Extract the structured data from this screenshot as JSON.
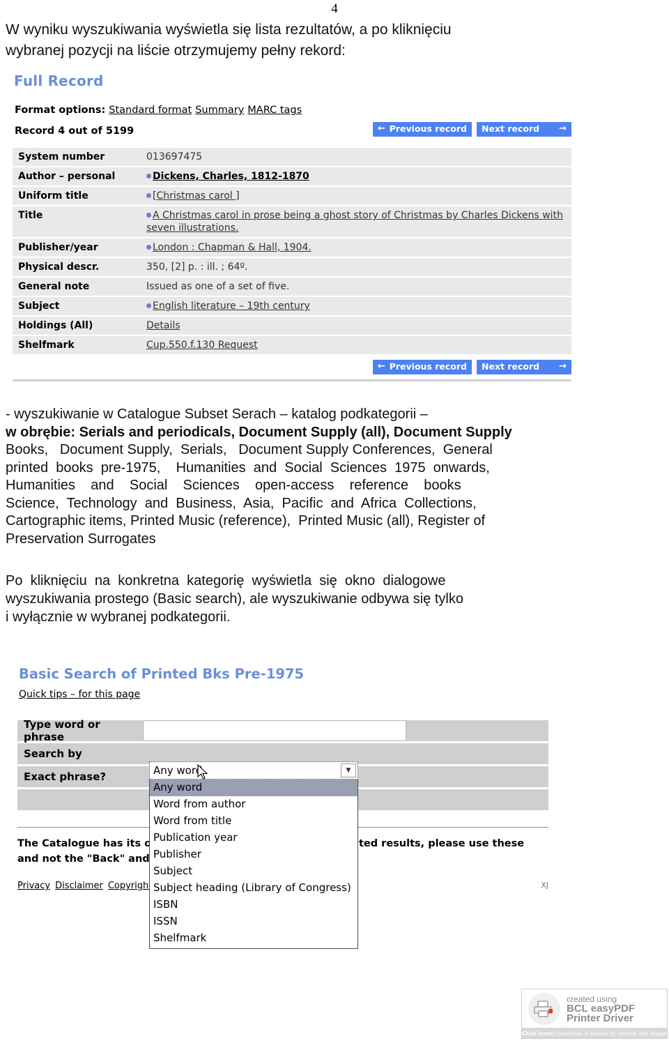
{
  "page": {
    "number": "4",
    "intro_line_1": "W  wyniku  wyszukiwania  wyświetla  się  lista  rezultatów,  a  po  kliknięciu",
    "intro_line_2": "wybranej pozycji na liście otrzymujemy pełny rekord:"
  },
  "full_record": {
    "title": "Full Record",
    "format_options_label": "Format options:",
    "format_options": [
      "Standard format",
      "Summary",
      "MARC tags"
    ],
    "record_counter": "Record 4 out of 5199",
    "nav": {
      "prev_label": "Previous record",
      "prev_arrow": "←",
      "next_label": "Next record",
      "next_arrow": "→"
    },
    "rows": [
      {
        "label": "System number",
        "value": "013697475",
        "bullet": false,
        "link": false
      },
      {
        "label": "Author – personal",
        "value": "Dickens, Charles, 1812-1870",
        "bullet": true,
        "link": true,
        "bold_prefix": "Dickens"
      },
      {
        "label": "Uniform title",
        "value": "[Christmas carol ]",
        "bullet": true,
        "link": true
      },
      {
        "label": "Title",
        "value": "A Christmas carol in prose being a ghost story of Christmas by Charles Dickens with seven illustrations.",
        "bullet": true,
        "link": true
      },
      {
        "label": "Publisher/year",
        "value": "London : Chapman & Hall, 1904.",
        "bullet": true,
        "link": true
      },
      {
        "label": "Physical descr.",
        "value": "350, [2] p. : ill. ; 64º.",
        "bullet": false,
        "link": false
      },
      {
        "label": "General note",
        "value": "Issued as one of a set of five.",
        "bullet": false,
        "link": false
      },
      {
        "label": "Subject",
        "value": "English literature – 19th century",
        "bullet": true,
        "link": true
      },
      {
        "label": "Holdings (All)",
        "value": "Details",
        "bullet": false,
        "link": true
      },
      {
        "label": "Shelfmark",
        "value": "Cup.550.f.130 Request",
        "bullet": false,
        "link": true
      }
    ]
  },
  "middle_text": {
    "line_1": "- wyszukiwanie w Catalogue Subset Serach – katalog podkategorii –",
    "line_2": "w obrębie: Serials and periodicals, Document Supply (all), Document Supply",
    "line_3": "Books,   Document Supply,  Serials,   Document Supply Conferences,  General",
    "line_4": "printed  books  pre-1975,    Humanities  and  Social  Sciences  1975  onwards,",
    "line_5": "Humanities    and    Social    Sciences    open-access    reference    books",
    "line_6": "Science,  Technology  and  Business,  Asia,  Pacific  and  Africa  Collections,",
    "line_7": "Cartographic items, Printed Music (reference),  Printed Music (all), Register of",
    "line_8": "Preservation Surrogates"
  },
  "paragraph_2": {
    "line_1": "Po  kliknięciu  na  konkretna  kategorię  wyświetla  się  okno  dialogowe",
    "line_2": "wyszukiwania prostego (Basic search), ale wyszukiwanie odbywa się tylko",
    "line_3": "i wyłącznie w wybranej podkategorii."
  },
  "basic_search": {
    "title": "Basic Search of Printed Bks Pre-1975",
    "quick_tips": "Quick tips – for this page",
    "fields": [
      {
        "label": "Type word or phrase",
        "type": "text",
        "value": ""
      },
      {
        "label": "Search by",
        "type": "select",
        "value": "Any word"
      },
      {
        "label": "Exact phrase?",
        "type": "checkbox",
        "value": ""
      },
      {
        "label": "",
        "type": "blank",
        "value": ""
      }
    ],
    "select_options": [
      "Any word",
      "Word from author",
      "Word from title",
      "Publication year",
      "Publisher",
      "Subject",
      "Subject heading (Library of Congress)",
      "ISBN",
      "ISSN",
      "Shelfmark"
    ],
    "select_selected": "Any word",
    "note_line_1": "The Catalogue has its own navigation buttons. To get expected results, please use these",
    "note_line_2": "and not the \"Back\" and \"Forward\" buttons of your browser.",
    "footer_links": [
      "Privacy",
      "Disclaimer",
      "Copyright"
    ],
    "footer_mark": "XJ"
  },
  "bcl_badge": {
    "line_1": "created using",
    "line_2": "BCL easyPDF",
    "line_3": "Printer Driver",
    "cta_bold": "Click here",
    "cta_rest": " to purchase a license to remove this image"
  }
}
